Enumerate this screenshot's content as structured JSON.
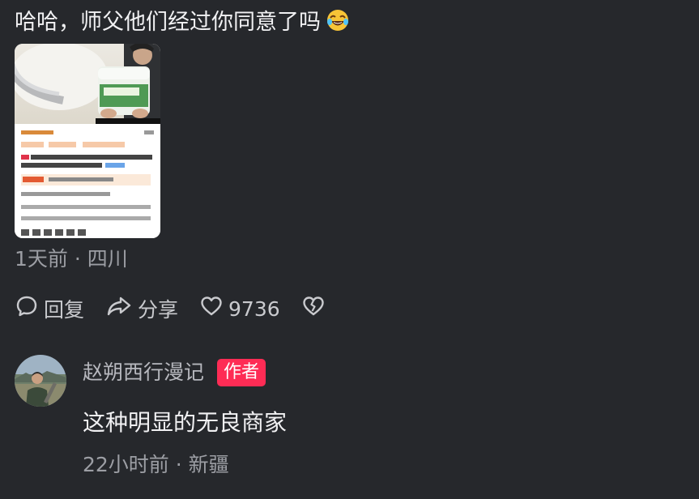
{
  "comment": {
    "text": "哈哈，师父他们经过你同意了吗",
    "emoji_icon": "rofl-emoji-icon",
    "meta": "1天前 · 四川"
  },
  "actions": {
    "reply_label": "回复",
    "share_label": "分享",
    "like_count": "9736"
  },
  "reply": {
    "author": "赵朔西行漫记",
    "badge": "作者",
    "text": "这种明显的无良商家",
    "meta": "22小时前 · 新疆"
  },
  "colors": {
    "background": "#26282c",
    "badge": "#fe2c55",
    "muted_text": "#9c9ea4"
  }
}
